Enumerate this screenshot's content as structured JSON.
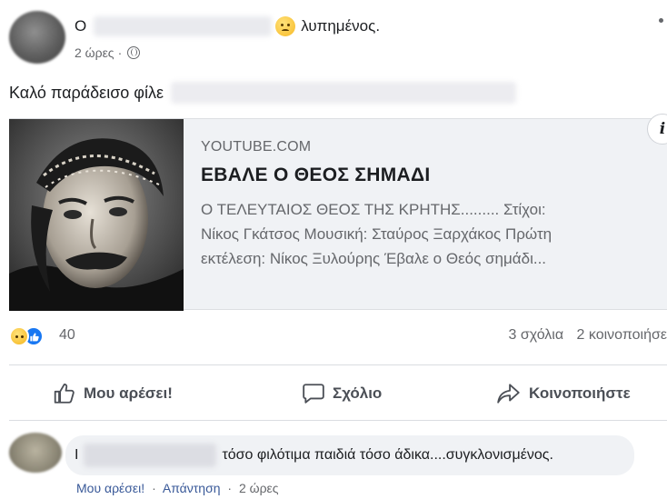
{
  "post": {
    "author_prefix": "Ο",
    "feeling": "λυπημένος.",
    "time": "2 ώρες",
    "separator": "·",
    "text": "Καλό παράδεισο φίλε"
  },
  "link_card": {
    "domain": "YOUTUBE.COM",
    "title": "ΕΒΑΛΕ Ο ΘΕΟΣ ΣΗΜΑΔΙ",
    "description_lines": [
      "Ο ΤΕΛΕΥΤΑΙΟΣ ΘΕΟΣ ΤΗΣ ΚΡΗΤΗΣ......... Στίχοι:",
      "Νίκος Γκάτσος Μουσική: Σταύρος Ξαρχάκος Πρώτη",
      "εκτέλεση: Νίκος Ξυλούρης Έβαλε ο Θεός σημάδι..."
    ],
    "info_label": "i"
  },
  "reactions": {
    "count": "40",
    "comments": "3 σχόλια",
    "shares": "2 κοινοποιήσε"
  },
  "actions": {
    "like": "Μου αρέσει!",
    "comment": "Σχόλιο",
    "share": "Κοινοποιήστε"
  },
  "comment": {
    "name_initial": "Ι",
    "text": "τόσο φιλότιμα παιδιά τόσο άδικα....συγκλονισμένος.",
    "like_link": "Μου αρέσει!",
    "reply_link": "Απάντηση",
    "time": "2 ώρες",
    "separator": "·"
  },
  "colors": {
    "like_blue": "#1877f2",
    "link_blue": "#385898",
    "secondary_text": "#65676b",
    "card_background": "#f0f2f5"
  }
}
